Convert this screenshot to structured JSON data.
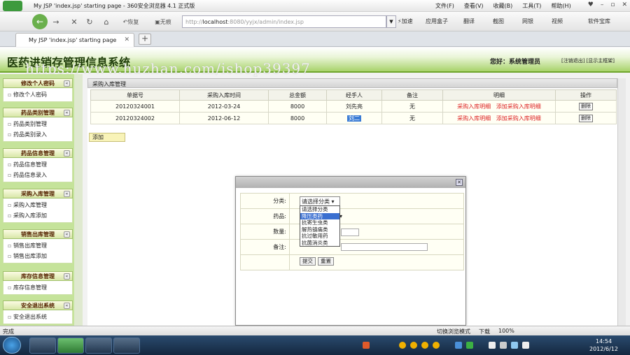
{
  "browser": {
    "title": "My JSP 'index.jsp' starting page - 360安全浏览器 4.1 正式版",
    "menus": [
      "文件(F)",
      "查看(V)",
      "收藏(B)",
      "工具(T)",
      "帮助(H)"
    ],
    "back_label": "恢复",
    "noimage_label": "无痕",
    "address": {
      "proto": "http://",
      "host": "localhost",
      "path": ":8080/yyjx/admin/index.jsp"
    },
    "speedup_label": "加速",
    "toolbar": [
      "应用盒子",
      "翻译",
      "截图",
      "网银",
      "视频",
      "软件宝库"
    ],
    "tab_label": "My JSP 'index.jsp' starting page"
  },
  "header": {
    "system_title": "医药进销存管理信息系统",
    "greeting": "您好：系统管理员",
    "logout_link": "[注销退出]",
    "home_link": "[显示主框架]",
    "watermark": "https://www.huzhan.com/ishop39397"
  },
  "sidebar": {
    "groups": [
      {
        "title": "修改个人密码",
        "items": [
          "修改个人密码"
        ]
      },
      {
        "title": "药品类别管理",
        "items": [
          "药品类别管理",
          "药品类别录入"
        ]
      },
      {
        "title": "药品信息管理",
        "items": [
          "药品信息管理",
          "药品信息录入"
        ]
      },
      {
        "title": "采购入库管理",
        "items": [
          "采购入库管理",
          "采购入库添加"
        ]
      },
      {
        "title": "销售出库管理",
        "items": [
          "销售出库管理",
          "销售出库添加"
        ]
      },
      {
        "title": "库存信息管理",
        "items": [
          "库存信息管理"
        ]
      },
      {
        "title": "安全退出系统",
        "items": [
          "安全退出系统"
        ]
      }
    ]
  },
  "main": {
    "panel_title": "采购入库管理",
    "columns": [
      "单据号",
      "采购入库时间",
      "总金额",
      "经手人",
      "备注",
      "明细",
      "操作"
    ],
    "rows": [
      {
        "id": "20120324001",
        "date": "2012-03-24",
        "total": "8000",
        "handler": "刘先亮",
        "note": "无",
        "detail": "采购入库明细",
        "add_detail": "添加采购入库明细",
        "op": "删除"
      },
      {
        "id": "20120324002",
        "date": "2012-06-12",
        "total": "8000",
        "handler": "刘二",
        "note": "无",
        "detail": "采购入库明细",
        "add_detail": "添加采购入库明细",
        "op": "删除"
      }
    ],
    "add_button": "添加"
  },
  "dialog": {
    "labels": {
      "category": "分类:",
      "drug": "药品:",
      "quantity": "数量:",
      "note": "备注:"
    },
    "category_selected": "请选择分类",
    "category_options": [
      "请选择分类",
      "降压类药",
      "抗寄生虫类",
      "解热镇痛类",
      "抗过敏用药",
      "抗菌消炎类"
    ],
    "submit_label": "提交",
    "reset_label": "重置"
  },
  "statusbar": {
    "left": "完成",
    "mode": "切换浏览模式",
    "download": "下载",
    "zoom": "100%"
  },
  "taskbar": {
    "time": "14:54",
    "date": "2012/6/12"
  }
}
